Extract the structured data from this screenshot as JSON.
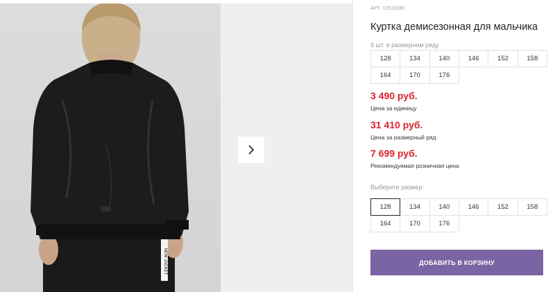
{
  "product": {
    "article": "АРТ. 12511095",
    "title": "Куртка демисезонная для мальчика",
    "row_count_text": "9 шт. в размерном ряду",
    "row_sizes": [
      "128",
      "134",
      "140",
      "146",
      "152",
      "158",
      "164",
      "170",
      "176"
    ]
  },
  "prices": [
    {
      "value": "3 490 руб.",
      "label": "Цена за единицу"
    },
    {
      "value": "31 410 руб.",
      "label": "Цена за размерный ряд"
    },
    {
      "value": "7 699 руб.",
      "label": "Рекомендуемая розничная цена"
    }
  ],
  "size_select": {
    "label": "Выберите размер:",
    "sizes": [
      "128",
      "134",
      "140",
      "146",
      "152",
      "158",
      "164",
      "170",
      "176"
    ],
    "selected": "128"
  },
  "cart": {
    "button_label": "ДОБАВИТЬ В КОРЗИНУ"
  },
  "gallery": {
    "next_icon": "chevron-right-icon",
    "sleeve_text": "NEW JACKET"
  },
  "colors": {
    "price": "#d9232e",
    "button": "#7a64a3"
  }
}
